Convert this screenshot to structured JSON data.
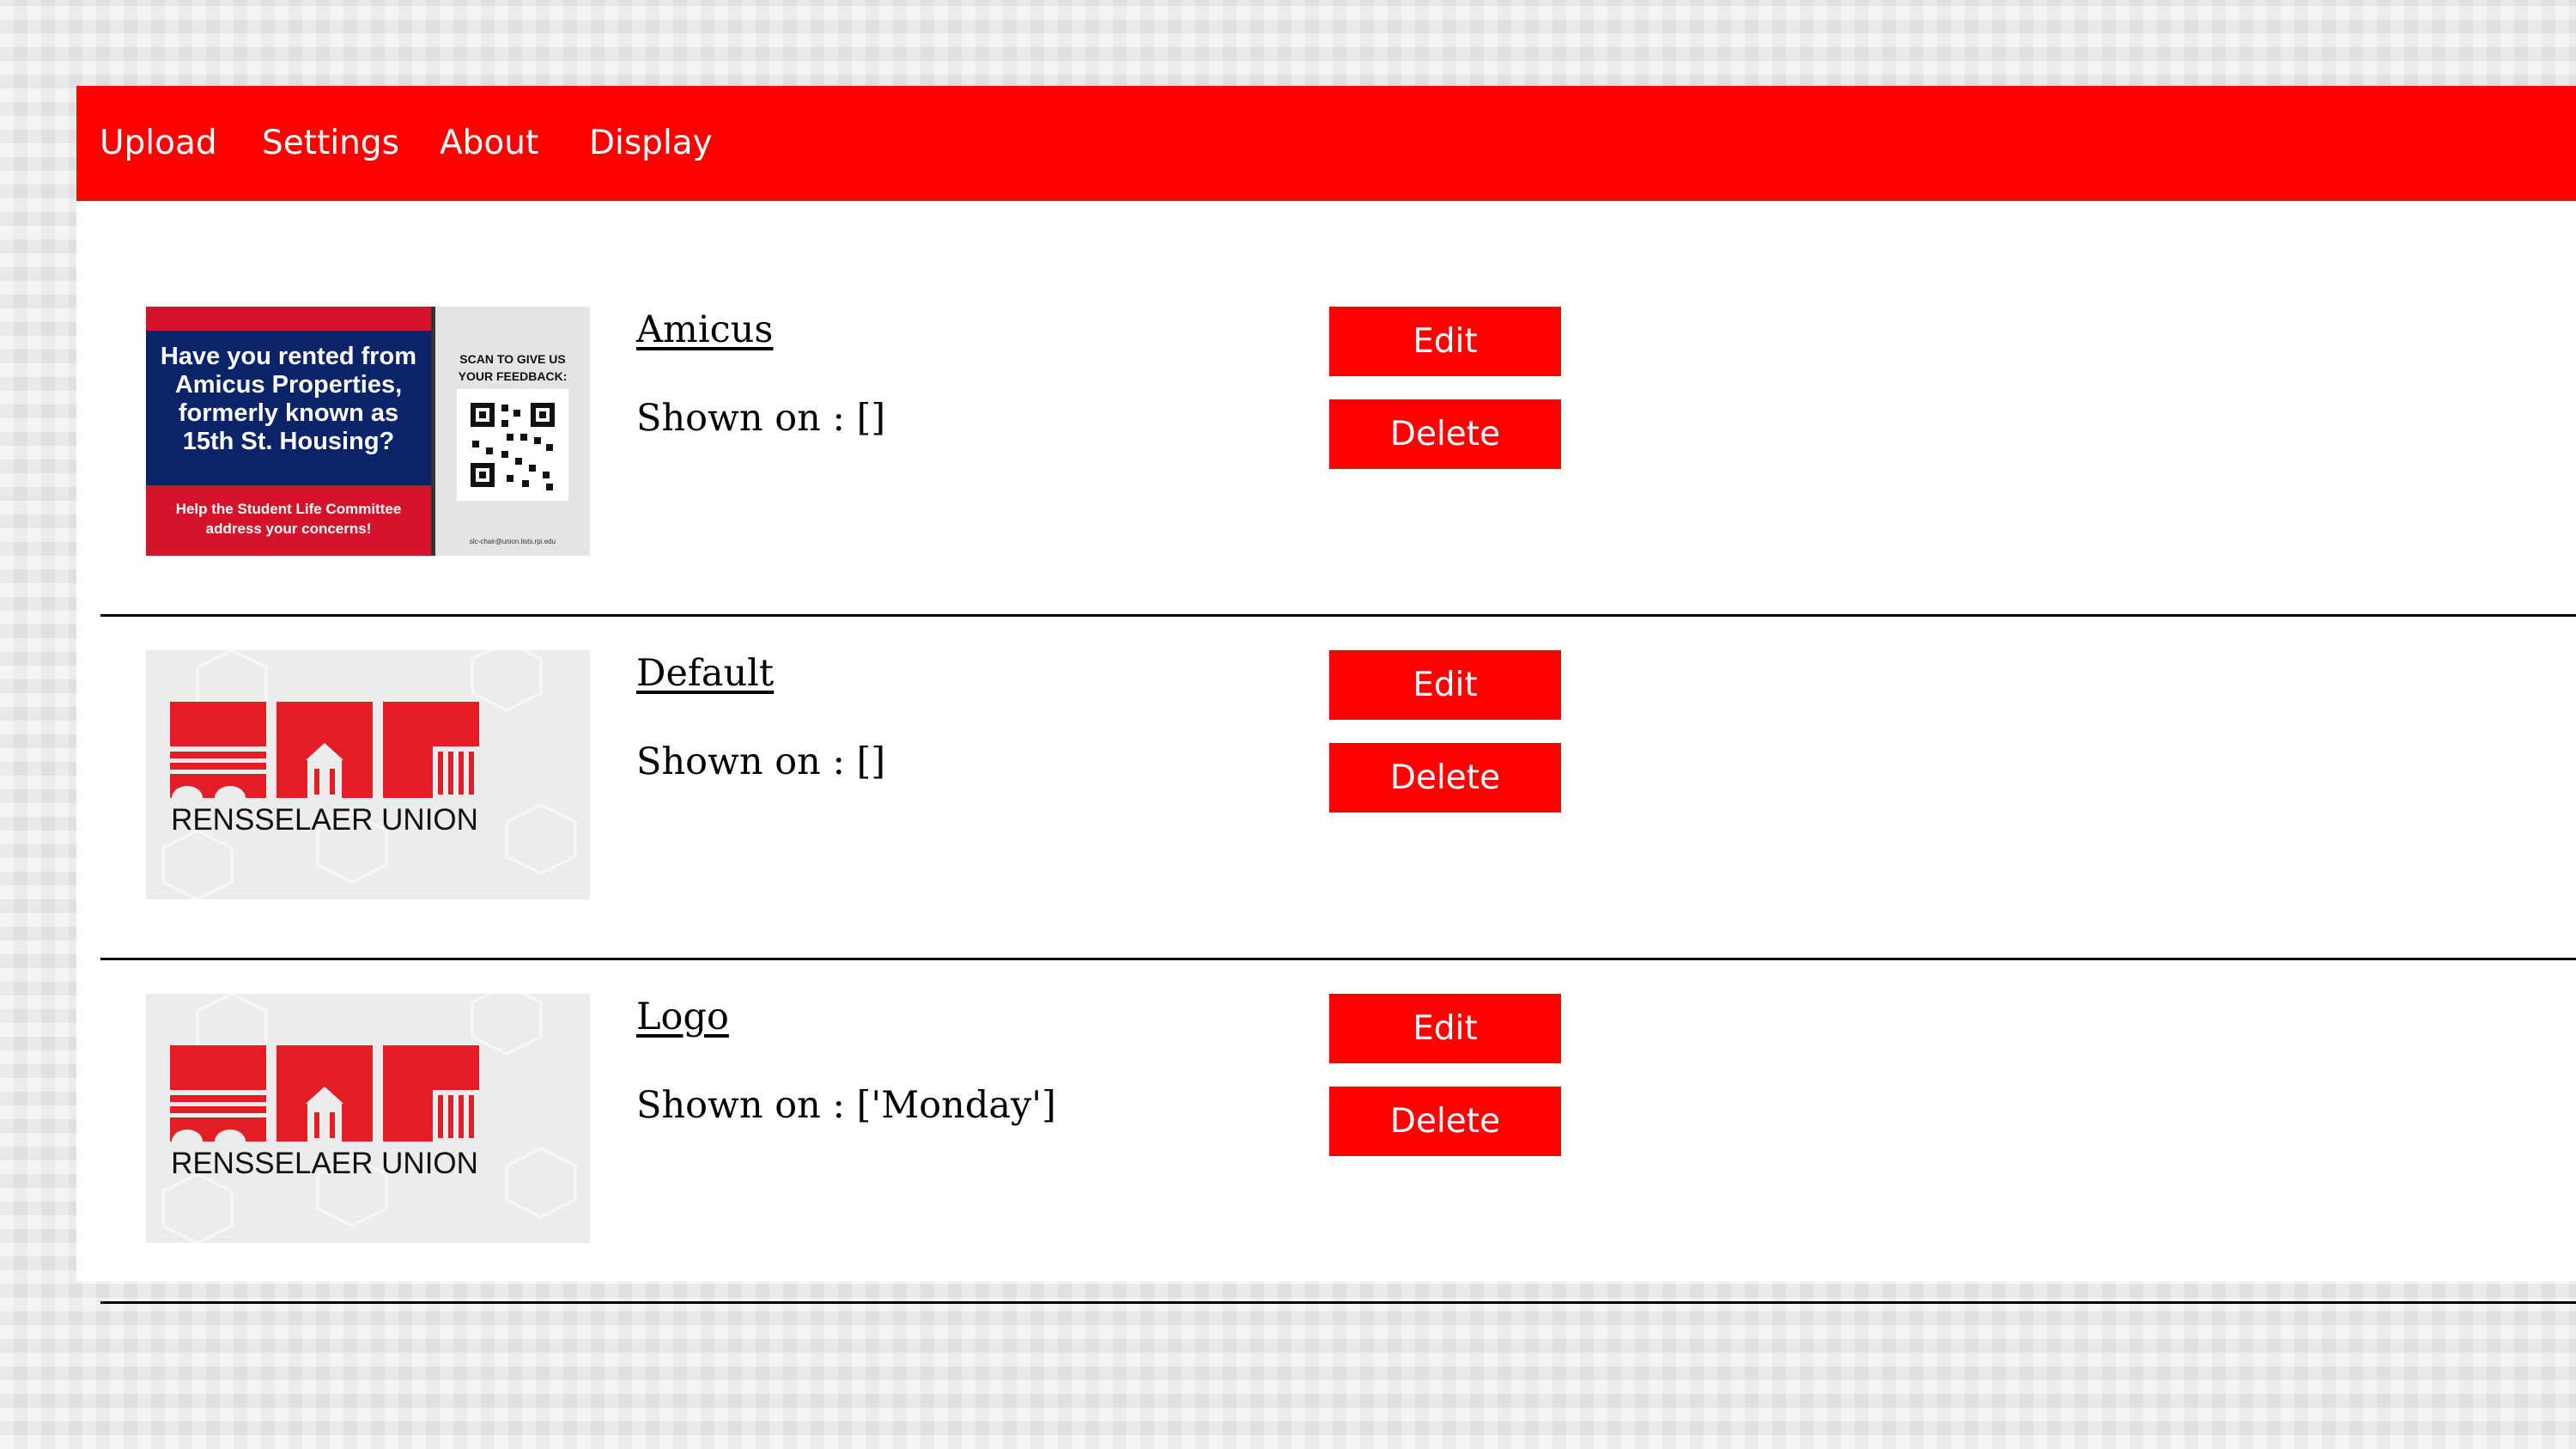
{
  "nav": {
    "items": [
      {
        "label": "Upload"
      },
      {
        "label": "Settings"
      },
      {
        "label": "About"
      },
      {
        "label": "Display"
      }
    ]
  },
  "colors": {
    "accent": "#ff0000",
    "flyer_navy": "#0b2469",
    "flyer_red": "#d4142a",
    "logo_red": "#e31e24"
  },
  "items": [
    {
      "name": "Amicus",
      "shown_on": "Shown on : []",
      "edit_label": "Edit",
      "delete_label": "Delete",
      "thumbnail": {
        "kind": "flyer",
        "headline": [
          "Have you rented from",
          "Amicus Properties,",
          "formerly known as",
          "15th St. Housing?"
        ],
        "subline": [
          "Help the Student Life Committee",
          "address your concerns!"
        ],
        "scan": [
          "SCAN TO GIVE US",
          "YOUR FEEDBACK:"
        ],
        "email": "slc-chair@union.lists.rpi.edu"
      }
    },
    {
      "name": "Default",
      "shown_on": "Shown on : []",
      "edit_label": "Edit",
      "delete_label": "Delete",
      "thumbnail": {
        "kind": "logo",
        "text": "RENSSELAER UNION"
      }
    },
    {
      "name": "Logo",
      "shown_on": "Shown on : ['Monday']",
      "edit_label": "Edit",
      "delete_label": "Delete",
      "thumbnail": {
        "kind": "logo",
        "text": "RENSSELAER UNION"
      }
    }
  ]
}
